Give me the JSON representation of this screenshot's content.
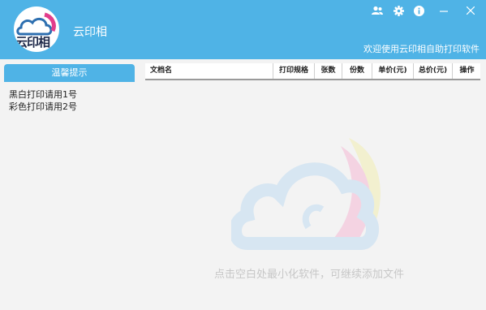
{
  "app": {
    "title": "云印相",
    "logo_text": "云印相",
    "welcome": "欢迎使用云印相自助打印软件"
  },
  "window_controls": {
    "icons": [
      "user-icon",
      "gear-icon",
      "info-icon",
      "minimize-icon",
      "close-icon"
    ]
  },
  "sidebar": {
    "title": "温馨提示",
    "tips": [
      "黑白打印请用1号",
      "彩色打印请用2号"
    ]
  },
  "table": {
    "columns": [
      "文档名",
      "打印规格",
      "张数",
      "份数",
      "单价(元)",
      "总价(元)",
      "操作"
    ]
  },
  "empty_hint": "点击空白处最小化软件，可继续添加文件",
  "colors": {
    "header": "#4fb3e6",
    "background": "#f3f3f3",
    "watermark_blue": "#d7e6f2",
    "watermark_pink": "#f4d3e2",
    "watermark_yellow": "#f2f0cf"
  }
}
